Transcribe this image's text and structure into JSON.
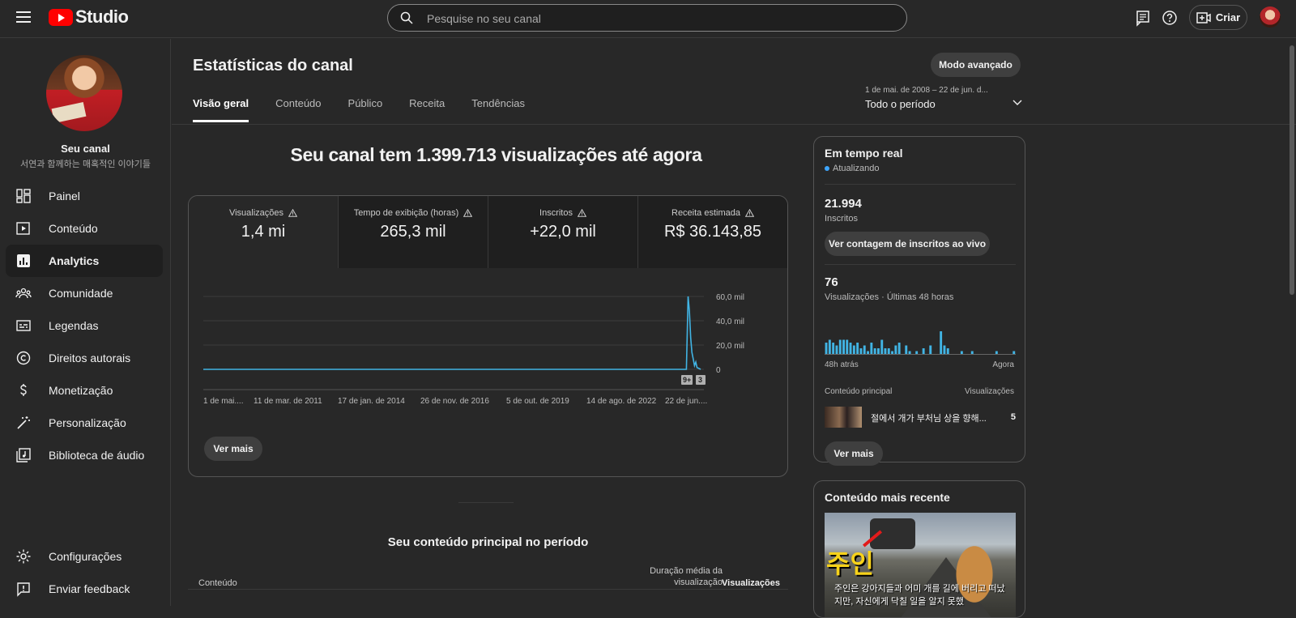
{
  "topbar": {
    "logo_text": "Studio",
    "search_placeholder": "Pesquise no seu canal",
    "create_label": "Criar"
  },
  "sidebar": {
    "channel_name": "Seu canal",
    "channel_subtitle": "서연과 함께하는 매혹적인 이야기들",
    "items": [
      {
        "label": "Painel",
        "icon": "dashboard-icon"
      },
      {
        "label": "Conteúdo",
        "icon": "content-icon"
      },
      {
        "label": "Analytics",
        "icon": "analytics-icon",
        "active": true
      },
      {
        "label": "Comunidade",
        "icon": "community-icon"
      },
      {
        "label": "Legendas",
        "icon": "subtitles-icon"
      },
      {
        "label": "Direitos autorais",
        "icon": "copyright-icon"
      },
      {
        "label": "Monetização",
        "icon": "dollar-icon"
      },
      {
        "label": "Personalização",
        "icon": "magic-wand-icon"
      },
      {
        "label": "Biblioteca de áudio",
        "icon": "audio-library-icon"
      }
    ],
    "bottom_items": [
      {
        "label": "Configurações",
        "icon": "gear-icon"
      },
      {
        "label": "Enviar feedback",
        "icon": "feedback-icon"
      }
    ]
  },
  "page": {
    "title": "Estatísticas do canal",
    "advanced_mode": "Modo avançado",
    "period_range": "1 de mai. de 2008 – 22 de jun. d...",
    "period_label": "Todo o período",
    "tabs": [
      "Visão geral",
      "Conteúdo",
      "Público",
      "Receita",
      "Tendências"
    ],
    "active_tab": 0,
    "headline": "Seu canal tem 1.399.713 visualizações até agora"
  },
  "metrics": [
    {
      "label": "Visualizações",
      "value": "1,4 mi"
    },
    {
      "label": "Tempo de exibição (horas)",
      "value": "265,3 mil"
    },
    {
      "label": "Inscritos",
      "value": "+22,0 mil"
    },
    {
      "label": "Receita estimada",
      "value": "R$ 36.143,85"
    }
  ],
  "chart_data": {
    "type": "line",
    "y_ticks": [
      "60,0 mil",
      "40,0 mil",
      "20,0 mil",
      "0"
    ],
    "ylim": [
      0,
      60000
    ],
    "x_ticks": [
      "1 de mai....",
      "11 de mar. de 2011",
      "17 de jan. de 2014",
      "26 de nov. de 2016",
      "5 de out. de 2019",
      "14 de ago. de 2022",
      "22 de jun...."
    ],
    "series": [
      {
        "color": "#41b4e4",
        "x": [
          "2008-05-01",
          "2011-03-11",
          "2014-01-17",
          "2016-11-26",
          "2019-10-05",
          "2022-08-14",
          "2024-01-05",
          "2024-01-25",
          "2024-02-10",
          "2024-02-25",
          "2024-03-10",
          "2024-03-25",
          "2024-04-10",
          "2024-04-25",
          "2024-05-10",
          "2024-05-25",
          "2024-06-22"
        ],
        "values": [
          0,
          0,
          0,
          0,
          0,
          0,
          0,
          60000,
          48000,
          26000,
          14000,
          9000,
          3000,
          6000,
          1500,
          1000,
          0
        ]
      }
    ],
    "badges": [
      "9+",
      "3"
    ],
    "grid": true
  },
  "chart_more": "Ver mais",
  "top_content": {
    "title": "Seu conteúdo principal no período",
    "col_content": "Conteúdo",
    "col_duration": "Duração média da visualização",
    "col_views": "Visualizações"
  },
  "realtime": {
    "title": "Em tempo real",
    "status": "Atualizando",
    "subscribers_value": "21.994",
    "subscribers_label": "Inscritos",
    "live_button": "Ver contagem de inscritos ao vivo",
    "views_value": "76",
    "views_label": "Visualizações · Últimas 48 horas",
    "axis_left": "48h atrás",
    "axis_right": "Agora",
    "bars": [
      4,
      5,
      4,
      3,
      5,
      5,
      5,
      4,
      3,
      4,
      2,
      3,
      1,
      4,
      2,
      2,
      5,
      2,
      2,
      1,
      3,
      4,
      0,
      3,
      1,
      0,
      1,
      0,
      2,
      0,
      3,
      0,
      0,
      8,
      3,
      2,
      0,
      0,
      0,
      1,
      0,
      0,
      1,
      0,
      0,
      0,
      0,
      0,
      0,
      1,
      0,
      0,
      0,
      0,
      1
    ],
    "col_content": "Conteúdo principal",
    "col_views": "Visualizações",
    "top_video_title": "절에서 개가 부처님 상을 향해...",
    "top_video_views": "5",
    "more_button": "Ver mais"
  },
  "recent": {
    "title": "Conteúdo mais recente",
    "thumb_text": "주인",
    "caption": "주인은 강아지들과 어미 개를 길에 버리고 떠났지만, 자신에게 닥칠 일을 알지 못했"
  }
}
